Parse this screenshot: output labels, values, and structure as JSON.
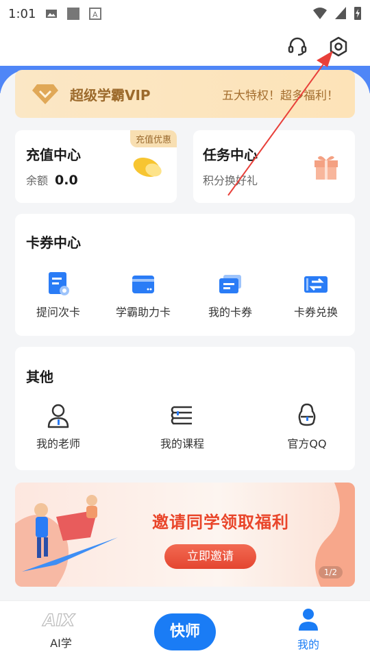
{
  "status_bar": {
    "time": "1:01"
  },
  "header": {
    "support_icon": "headset-icon",
    "settings_icon": "settings-icon"
  },
  "vip": {
    "title": "超级学霸VIP",
    "perk_text": "五大特权！超多福利！"
  },
  "recharge": {
    "title": "充值中心",
    "balance_label": "余额",
    "balance_value": "0.0",
    "tag": "充值优惠"
  },
  "tasks": {
    "title": "任务中心",
    "subtitle": "积分换好礼"
  },
  "card_center": {
    "title": "卡券中心",
    "items": [
      {
        "label": "提问次卡",
        "icon": "question-card-icon"
      },
      {
        "label": "学霸助力卡",
        "icon": "wallet-card-icon"
      },
      {
        "label": "我的卡券",
        "icon": "ticket-icon"
      },
      {
        "label": "卡券兑换",
        "icon": "exchange-icon"
      }
    ]
  },
  "others": {
    "title": "其他",
    "items": [
      {
        "label": "我的老师",
        "icon": "teacher-icon"
      },
      {
        "label": "我的课程",
        "icon": "course-icon"
      },
      {
        "label": "官方QQ",
        "icon": "qq-icon"
      }
    ]
  },
  "banner": {
    "headline": "邀请同学领取福利",
    "button": "立即邀请",
    "pager": "1/2"
  },
  "bottom_nav": {
    "left_label": "AI学",
    "center_label": "快师",
    "right_label": "我的"
  },
  "colors": {
    "accent": "#1a7cf5",
    "vip_text": "#9c6a2c",
    "banner_red": "#e9452a"
  }
}
